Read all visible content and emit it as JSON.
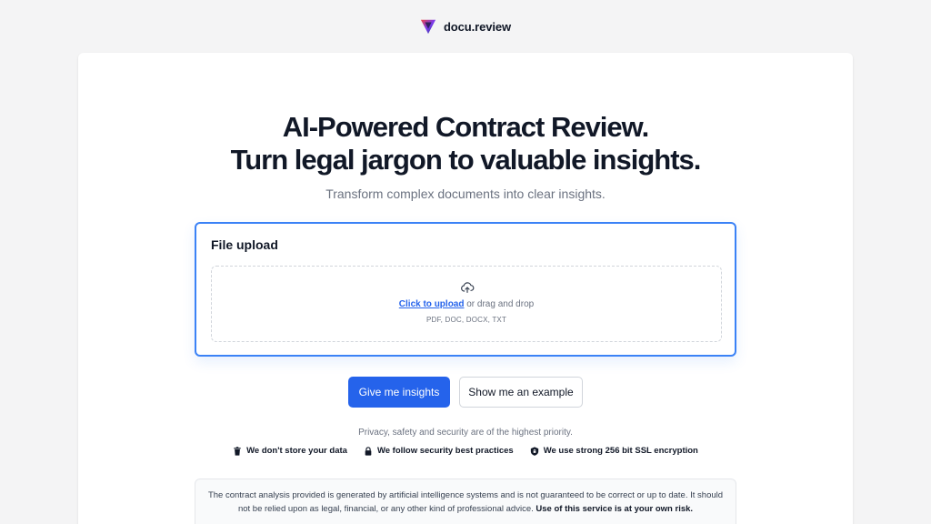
{
  "header": {
    "brand_name": "docu.review",
    "logo_icon": "v-logo-icon"
  },
  "hero": {
    "title_line1": "AI-Powered Contract Review.",
    "title_line2": "Turn legal jargon to valuable insights.",
    "subtitle": "Transform complex documents into clear insights."
  },
  "upload": {
    "title": "File upload",
    "icon": "cloud-upload-icon",
    "link_text": "Click to upload",
    "helper_text": " or drag and drop",
    "file_types": "PDF, DOC, DOCX, TXT"
  },
  "actions": {
    "primary_label": "Give me insights",
    "secondary_label": "Show me an example"
  },
  "privacy": {
    "text": "Privacy, safety and security are of the highest priority.",
    "badges": [
      {
        "icon": "trash-icon",
        "label": "We don't store your data"
      },
      {
        "icon": "lock-icon",
        "label": "We follow security best practices"
      },
      {
        "icon": "shield-lock-icon",
        "label": "We use strong 256 bit SSL encryption"
      }
    ]
  },
  "disclaimer": {
    "text": "The contract analysis provided is generated by artificial intelligence systems and is not guaranteed to be correct or up to date. It should not be relied upon as legal, financial, or any other kind of professional advice. ",
    "bold_text": "Use of this service is at your own risk."
  },
  "colors": {
    "accent": "#2563eb",
    "focus_border": "#3b82f6",
    "background": "#f4f4f5",
    "text": "#111827",
    "muted": "#6b7280"
  }
}
